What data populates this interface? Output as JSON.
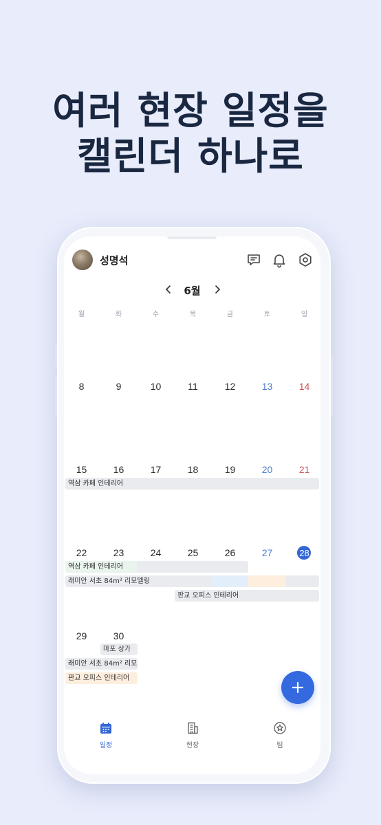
{
  "headline": {
    "line1": "여러 현장 일정을",
    "line2": "캘린더 하나로"
  },
  "header": {
    "username": "성명석"
  },
  "calendar": {
    "month": "6월",
    "weekdays": [
      "월",
      "화",
      "수",
      "목",
      "금",
      "토",
      "일"
    ],
    "weeks": [
      [
        "8",
        "9",
        "10",
        "11",
        "12",
        "13",
        "14"
      ],
      [
        "15",
        "16",
        "17",
        "18",
        "19",
        "20",
        "21"
      ],
      [
        "22",
        "23",
        "24",
        "25",
        "26",
        "27",
        "28"
      ],
      [
        "29",
        "30"
      ]
    ],
    "today": "28",
    "events": {
      "yeoksam": "역삼 카페 인테리어",
      "yeoksam2": "역삼 카페 인테리어",
      "raemian": "래미안 서초 84m² 리모델링",
      "pangyo": "판교 오피스 인테리어",
      "mapo": "마포 상가",
      "raemian2": "래미안 서초 84m² 리모",
      "pangyo2": "판교 오피스 인테리어"
    }
  },
  "tabs": [
    {
      "label": "일정",
      "icon": "calendar-icon"
    },
    {
      "label": "현장",
      "icon": "building-icon"
    },
    {
      "label": "팀",
      "icon": "team-icon"
    }
  ],
  "colors": {
    "accent": "#3367d6",
    "saturday": "#4a7bd0",
    "sunday": "#d05252",
    "background": "#e8ecfb"
  }
}
